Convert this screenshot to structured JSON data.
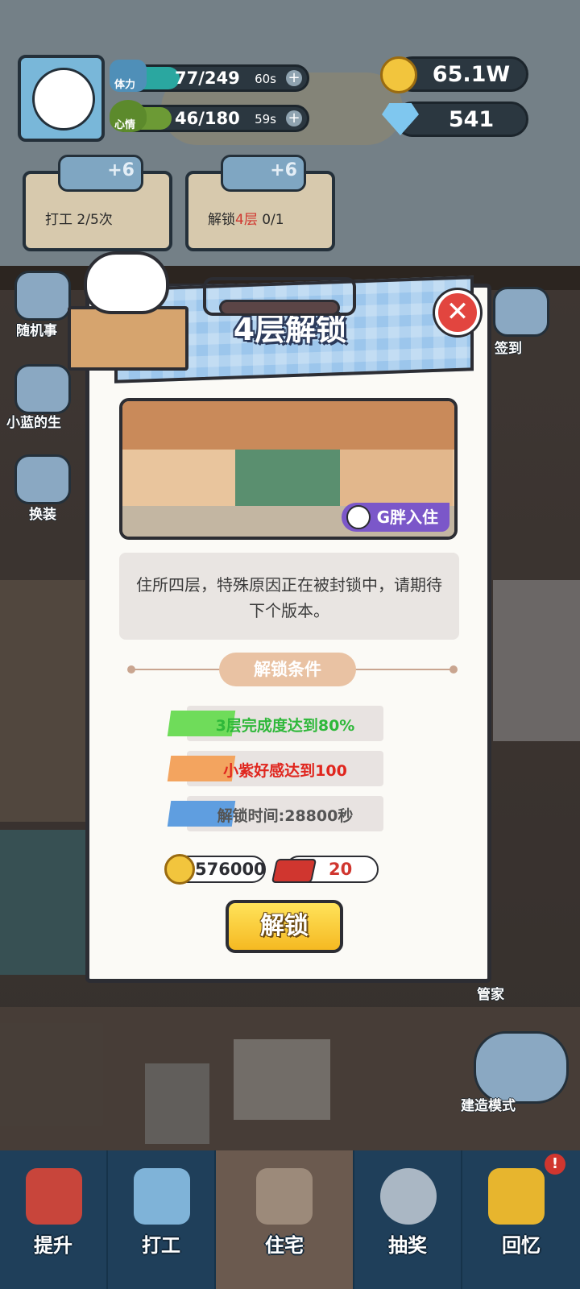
{
  "player": {
    "stamina": {
      "label": "体力",
      "value": "77/249",
      "timer": "60s",
      "fill": 0.31
    },
    "mood": {
      "label": "心情",
      "value": "46/180",
      "timer": "59s",
      "fill": 0.26
    }
  },
  "currency": {
    "coins": "65.1W",
    "gems": "541"
  },
  "tasks": [
    {
      "bonus": "+6",
      "text": "打工 2/5次"
    },
    {
      "bonus": "+6",
      "text_prefix": "解锁",
      "text_highlight": "4层",
      "text_suffix": " 0/1"
    }
  ],
  "side_buttons": {
    "random_event": "随机事",
    "xiaolan_life": "小蓝的生",
    "dress_up": "换装",
    "sign_in": "签到",
    "butler": "管家",
    "build_mode": "建造模式"
  },
  "modal": {
    "title": "4层解锁",
    "close_symbol": "✕",
    "badge": "G胖入住",
    "description": "住所四层，特殊原因正在被封锁中，请期待下个版本。",
    "conditions_title": "解锁条件",
    "conditions": [
      {
        "text": "3层完成度达到80%",
        "text_color": "#2fb83a",
        "tag_color": "#6fdc5a"
      },
      {
        "text": "小紫好感达到100",
        "text_color": "#e0261e",
        "tag_color": "#f3a45f"
      },
      {
        "text": "解锁时间:28800秒",
        "text_color": "#555555",
        "tag_color": "#5f9ee0"
      }
    ],
    "cost": {
      "coins": "576000",
      "bricks": "20"
    },
    "unlock_button": "解锁"
  },
  "nav": {
    "tabs": [
      {
        "label": "提升",
        "active": false
      },
      {
        "label": "打工",
        "active": false
      },
      {
        "label": "住宅",
        "active": true
      },
      {
        "label": "抽奖",
        "active": false
      },
      {
        "label": "回忆",
        "active": false
      }
    ],
    "alert_badge": "!"
  }
}
